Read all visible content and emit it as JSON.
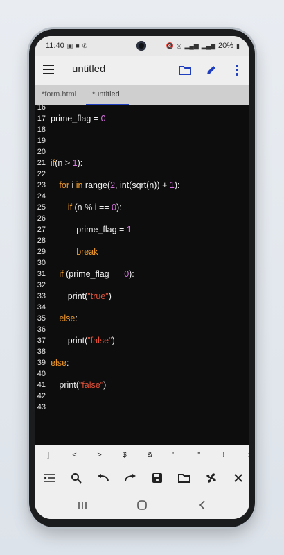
{
  "status": {
    "time": "11:40",
    "battery": "20%"
  },
  "toolbar": {
    "title": "untitled"
  },
  "tabs": [
    {
      "label": "*form.html"
    },
    {
      "label": "*untitled"
    }
  ],
  "editor": {
    "lines": [
      {
        "n": "16",
        "code": ""
      },
      {
        "n": "17",
        "code": "prime_flag = 0"
      },
      {
        "n": "18",
        "code": ""
      },
      {
        "n": "19",
        "code": ""
      },
      {
        "n": "20",
        "code": ""
      },
      {
        "n": "21",
        "code": "if(n > 1):"
      },
      {
        "n": "22",
        "code": ""
      },
      {
        "n": "23",
        "code": "    for i in range(2, int(sqrt(n)) + 1):"
      },
      {
        "n": "24",
        "code": ""
      },
      {
        "n": "25",
        "code": "        if (n % i == 0):"
      },
      {
        "n": "26",
        "code": ""
      },
      {
        "n": "27",
        "code": "            prime_flag = 1"
      },
      {
        "n": "28",
        "code": ""
      },
      {
        "n": "29",
        "code": "            break"
      },
      {
        "n": "30",
        "code": ""
      },
      {
        "n": "31",
        "code": "    if (prime_flag == 0):"
      },
      {
        "n": "32",
        "code": ""
      },
      {
        "n": "33",
        "code": "        print(\"true\")"
      },
      {
        "n": "34",
        "code": ""
      },
      {
        "n": "35",
        "code": "    else:"
      },
      {
        "n": "36",
        "code": ""
      },
      {
        "n": "37",
        "code": "        print(\"false\")"
      },
      {
        "n": "38",
        "code": ""
      },
      {
        "n": "39",
        "code": "else:"
      },
      {
        "n": "40",
        "code": ""
      },
      {
        "n": "41",
        "code": "    print(\"false\")"
      },
      {
        "n": "42",
        "code": ""
      },
      {
        "n": "43",
        "code": ""
      }
    ]
  },
  "symbols": [
    "]",
    "<",
    ">",
    "$",
    "&",
    "'",
    "\"",
    "!",
    ":"
  ],
  "icons": {
    "toolbar": [
      "menu-icon",
      "folder-icon",
      "pencil-icon",
      "more-vert-icon"
    ],
    "actions": [
      "indent-icon",
      "search-icon",
      "undo-icon",
      "redo-icon",
      "save-icon",
      "open-folder-icon",
      "fan-icon",
      "close-icon"
    ],
    "nav": [
      "recents-icon",
      "home-icon",
      "back-icon"
    ]
  },
  "colors": {
    "accent": "#1f3fbf",
    "keyword": "#f09a2a",
    "number": "#d875e0",
    "string": "#e1523a",
    "editor_bg": "#0d0d0d"
  }
}
